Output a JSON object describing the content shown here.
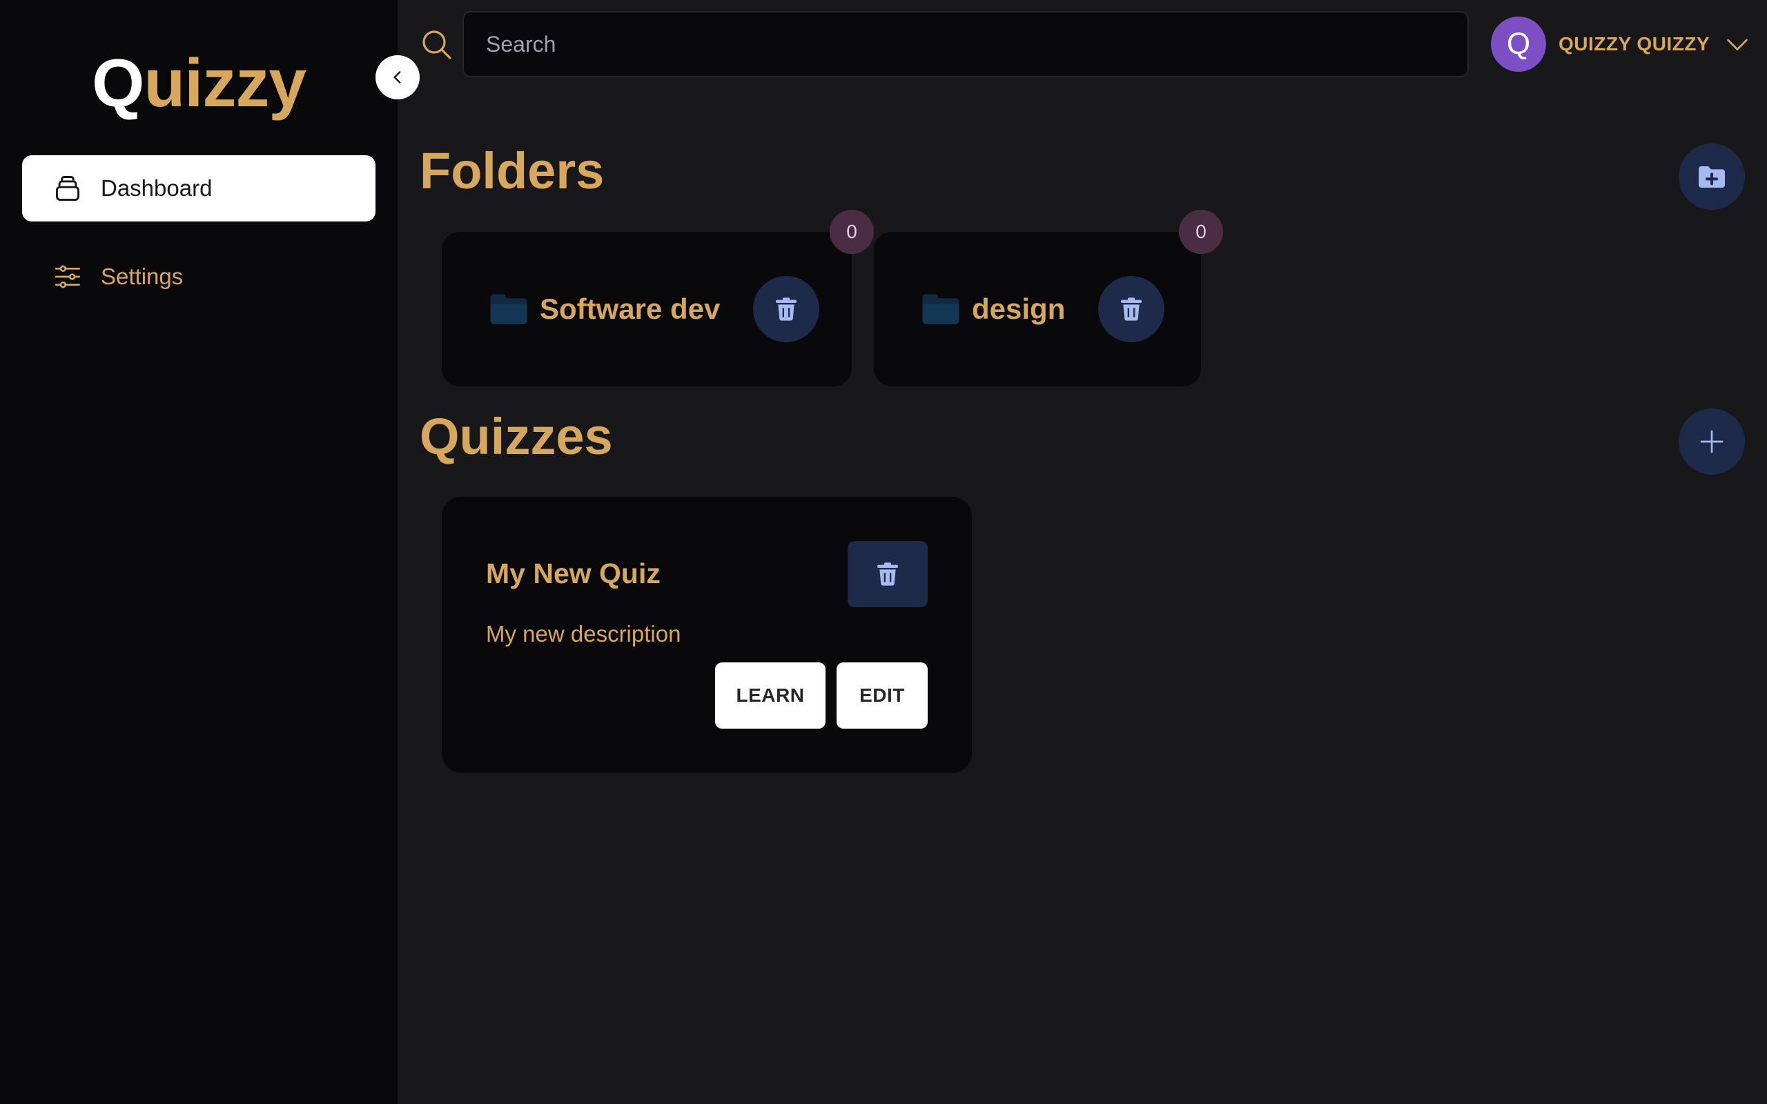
{
  "app": {
    "logo_first": "Q",
    "logo_rest": "uizzy"
  },
  "sidebar": {
    "items": [
      {
        "label": "Dashboard",
        "icon": "inbox-stack-icon",
        "active": true
      },
      {
        "label": "Settings",
        "icon": "sliders-icon",
        "active": false
      }
    ]
  },
  "search": {
    "placeholder": "Search",
    "value": ""
  },
  "user": {
    "initial": "Q",
    "name": "QUIZZY QUIZZY"
  },
  "folders": {
    "title": "Folders",
    "items": [
      {
        "name": "Software dev",
        "count": "0"
      },
      {
        "name": "design",
        "count": "0"
      }
    ]
  },
  "quizzes": {
    "title": "Quizzes",
    "items": [
      {
        "title": "My New Quiz",
        "description": "My new description",
        "learn_label": "LEARN",
        "edit_label": "EDIT"
      }
    ]
  },
  "colors": {
    "accent": "#d6a75c",
    "sidebar_bg": "#09090b",
    "main_bg": "#18181b",
    "button_bg": "#1e2a4a",
    "avatar": "#7e4fc4",
    "badge": "#4a2d45"
  }
}
